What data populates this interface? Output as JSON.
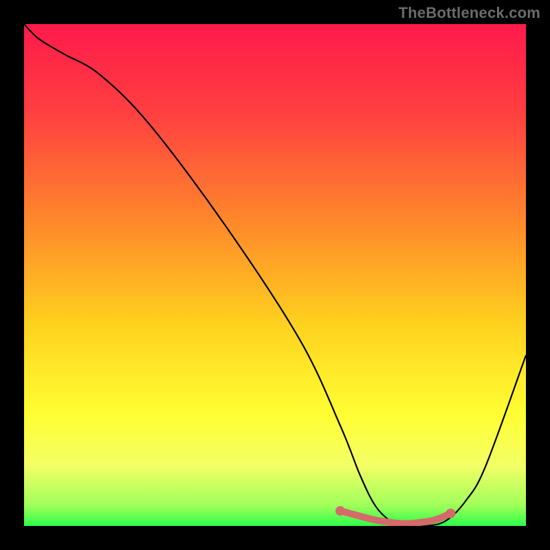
{
  "watermark": "TheBottleneck.com",
  "chart_data": {
    "type": "line",
    "title": "",
    "xlabel": "",
    "ylabel": "",
    "xlim": [
      0,
      100
    ],
    "ylim": [
      0,
      100
    ],
    "gradient_stops": [
      {
        "offset": 0,
        "color": "#ff1a4b"
      },
      {
        "offset": 18,
        "color": "#ff4040"
      },
      {
        "offset": 40,
        "color": "#ff8a2a"
      },
      {
        "offset": 60,
        "color": "#ffd21f"
      },
      {
        "offset": 78,
        "color": "#ffff33"
      },
      {
        "offset": 88,
        "color": "#f3ff66"
      },
      {
        "offset": 96,
        "color": "#9fff5a"
      },
      {
        "offset": 100,
        "color": "#2bff4a"
      }
    ],
    "series": [
      {
        "name": "bottleneck-curve",
        "color": "#000000",
        "x": [
          0,
          3,
          8,
          15,
          25,
          40,
          55,
          63,
          67,
          70,
          73,
          76,
          80,
          84,
          88,
          92,
          100
        ],
        "y": [
          100,
          97,
          94,
          90,
          80,
          60,
          37,
          20,
          10,
          4,
          1,
          0,
          0,
          1,
          5,
          12,
          34
        ]
      }
    ],
    "highlight": {
      "name": "optimal-range",
      "color": "#d46a6a",
      "x": [
        63,
        66,
        69,
        71,
        73,
        75,
        77,
        79,
        81,
        83,
        85
      ],
      "y": [
        3,
        2.2,
        1.4,
        1.0,
        0.7,
        0.5,
        0.5,
        0.7,
        1.0,
        1.6,
        2.5
      ]
    }
  }
}
